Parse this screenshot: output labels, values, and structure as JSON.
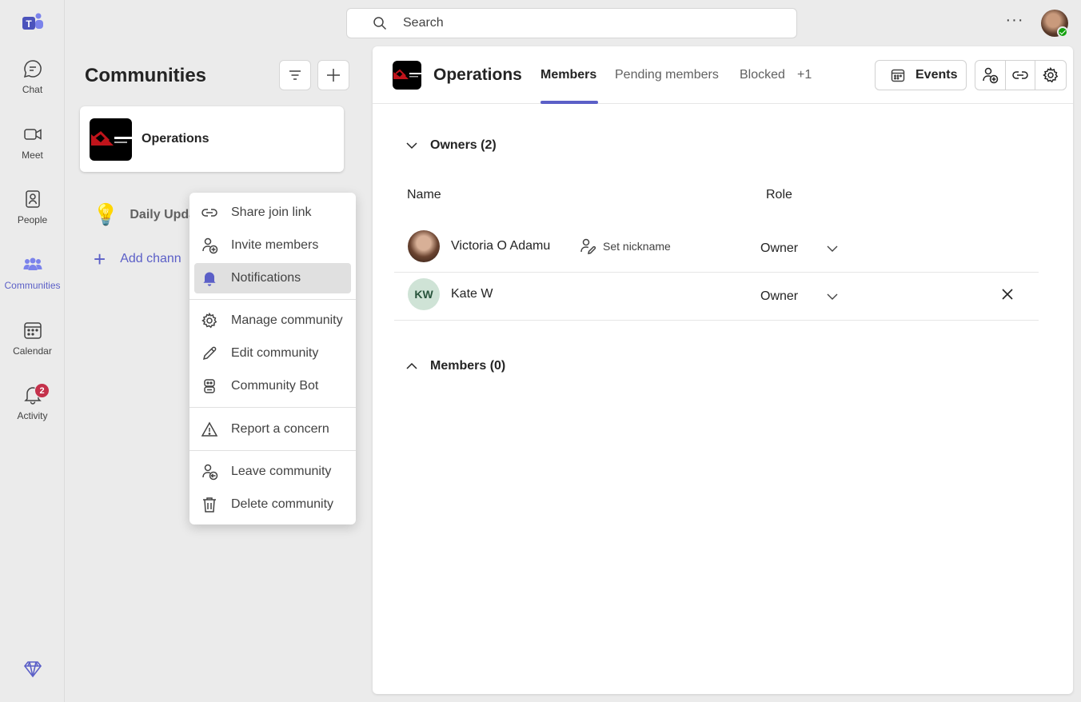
{
  "rail": {
    "items": [
      {
        "label": "Chat",
        "icon": "chat-icon"
      },
      {
        "label": "Meet",
        "icon": "video-icon"
      },
      {
        "label": "People",
        "icon": "people-icon"
      },
      {
        "label": "Communities",
        "icon": "communities-icon",
        "active": true
      },
      {
        "label": "Calendar",
        "icon": "calendar-icon"
      },
      {
        "label": "Activity",
        "icon": "bell-icon",
        "badge": "2"
      }
    ]
  },
  "search": {
    "placeholder": "Search"
  },
  "more": "···",
  "panel": {
    "title": "Communities",
    "community": {
      "name": "Operations"
    },
    "channel": {
      "name": "Daily Upda",
      "emoji": "💡"
    },
    "add_channel": "Add chann"
  },
  "menu": {
    "items": [
      {
        "label": "Share join link",
        "icon": "link-icon"
      },
      {
        "label": "Invite members",
        "icon": "person-add-icon"
      },
      {
        "label": "Notifications",
        "icon": "bell-filled-icon",
        "selected": true
      },
      {
        "label": "Manage community",
        "icon": "gear-icon"
      },
      {
        "label": "Edit community",
        "icon": "pencil-icon"
      },
      {
        "label": "Community Bot",
        "icon": "bot-icon"
      },
      {
        "label": "Report a concern",
        "icon": "warning-icon"
      },
      {
        "label": "Leave community",
        "icon": "person-leave-icon"
      },
      {
        "label": "Delete community",
        "icon": "trash-icon"
      }
    ]
  },
  "main": {
    "title": "Operations",
    "tabs": [
      {
        "label": "Members",
        "active": true
      },
      {
        "label": "Pending members"
      },
      {
        "label": "Blocked"
      },
      {
        "label": "+1"
      }
    ],
    "events_label": "Events",
    "owners_section": "Owners (2)",
    "members_section": "Members (0)",
    "columns": {
      "name": "Name",
      "role": "Role"
    },
    "owners": [
      {
        "name": "Victoria O Adamu",
        "avatar": "photo",
        "nickname_action": "Set nickname",
        "role": "Owner"
      },
      {
        "name": "Kate W",
        "avatar": "initials",
        "initials": "KW",
        "role": "Owner",
        "removable": true
      }
    ]
  },
  "colors": {
    "accent": "#5b5fc7",
    "badge": "#c4314b",
    "presence": "#13a10e"
  }
}
